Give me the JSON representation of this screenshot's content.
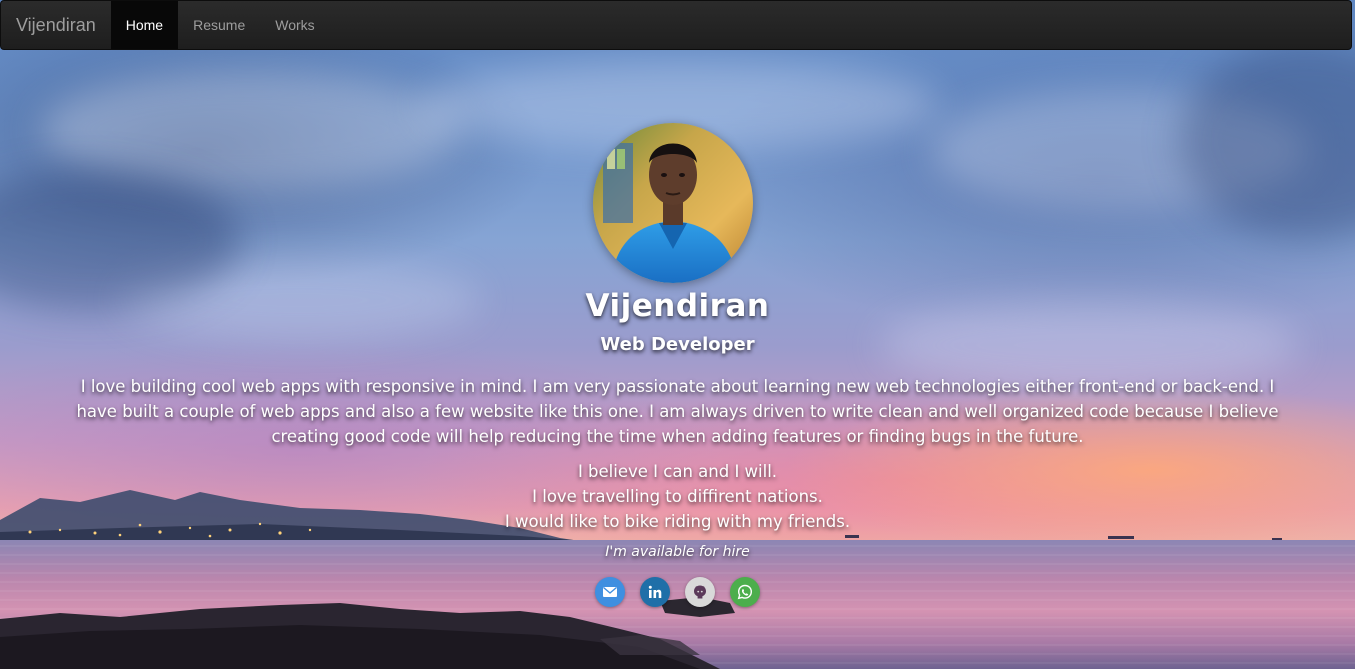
{
  "navbar": {
    "brand": "Vijendiran",
    "items": [
      {
        "label": "Home",
        "active": true
      },
      {
        "label": "Resume",
        "active": false
      },
      {
        "label": "Works",
        "active": false
      }
    ]
  },
  "profile": {
    "name": "Vijendiran",
    "title": "Web Developer",
    "bio": "I love building cool web apps with responsive in mind. I am very passionate about learning new web technologies either front-end or back-end. I have built a couple of web apps and also a few website like this one. I am always driven to write clean and well organized code because I believe creating good code will help reducing the time when adding features or finding bugs in the future.",
    "lines": [
      "I believe I can and I will.",
      "I love travelling to diffirent nations.",
      "I would like to bike riding with my friends."
    ],
    "availability": "I'm available for hire"
  },
  "social": [
    {
      "icon": "email-icon",
      "color": "#3f8fe0"
    },
    {
      "icon": "linkedin-icon",
      "color": "#1f6fa8"
    },
    {
      "icon": "github-icon",
      "color": "#d9d9d9"
    },
    {
      "icon": "whatsapp-icon",
      "color": "#4cae4c"
    }
  ],
  "colors": {
    "navbar_bg": "#222222",
    "nav_active_bg": "#080808",
    "nav_text": "#9d9d9d"
  }
}
